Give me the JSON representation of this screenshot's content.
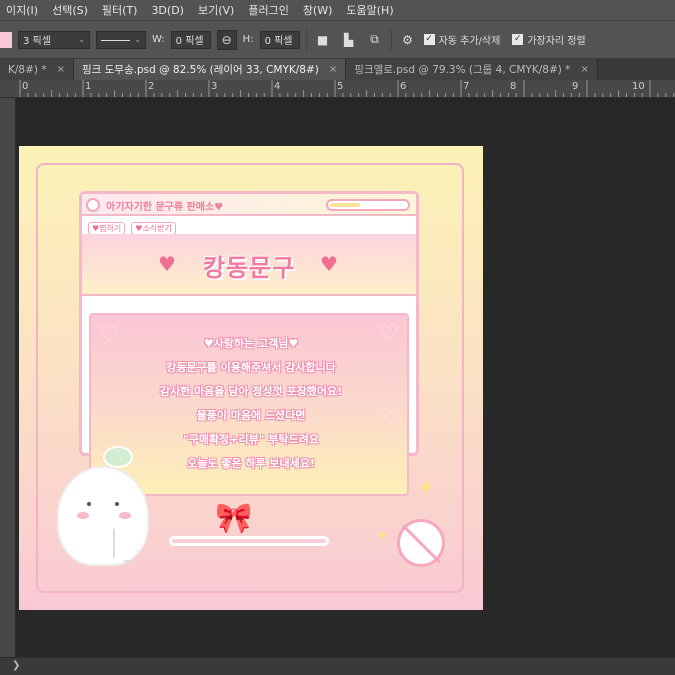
{
  "menubar": {
    "items": [
      "이지(I)",
      "선택(S)",
      "필터(T)",
      "3D(D)",
      "보기(V)",
      "플러그인",
      "창(W)",
      "도움말(H)"
    ]
  },
  "options": {
    "stroke_width": "3 픽셀",
    "w_label": "W:",
    "w_value": "0 픽셀",
    "h_label": "H:",
    "h_value": "0 픽셀",
    "auto_add_delete": "자동 추가/삭제",
    "align_edges": "가장자리 정렬",
    "swatch_color": "#f7c6d9"
  },
  "tabs": [
    {
      "label": "K/8#) *",
      "close": "×",
      "active": false
    },
    {
      "label": "핑크 도무송.psd @ 82.5% (레이어 33, CMYK/8#)",
      "close": "×",
      "active": true
    },
    {
      "label": "핑크옐로.psd @ 79.3% (그룹 4, CMYK/8#) *",
      "close": "×",
      "active": false
    }
  ],
  "ruler": {
    "labels": [
      "0",
      "1",
      "2",
      "3",
      "4",
      "5",
      "6",
      "7",
      "8",
      "9",
      "10"
    ]
  },
  "artwork": {
    "window_title": "아기자기한 문구류 판매소♥",
    "chip1": "♥찜하기",
    "chip2": "♥소식받기",
    "banner_title": "캉동문구",
    "messages": [
      "♥사랑하는 고객님♥",
      "캉동문구를 이용해주셔서 감사합니다",
      "감사한 마음을 담아 정성껏 포장했어요!",
      "물품이 마음에 드셨다면",
      "\"구매확정+리뷰\" 부탁드려요",
      "오늘도 좋은 하루 보내세요!"
    ],
    "progress_fraction": 0.4
  },
  "status": {
    "arrow": "❯"
  }
}
